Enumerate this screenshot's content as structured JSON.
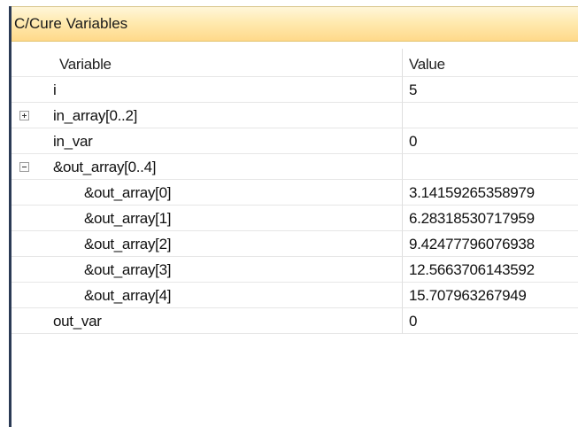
{
  "window": {
    "title": "C/Cure Variables"
  },
  "table": {
    "headers": {
      "variable": "Variable",
      "value": "Value"
    },
    "rows": [
      {
        "name": "i",
        "value": "5",
        "indent": 1,
        "expander": null
      },
      {
        "name": "in_array[0..2]",
        "value": "",
        "indent": 1,
        "expander": "collapsed"
      },
      {
        "name": "in_var",
        "value": "0",
        "indent": 1,
        "expander": null
      },
      {
        "name": "&out_array[0..4]",
        "value": "",
        "indent": 1,
        "expander": "expanded"
      },
      {
        "name": "&out_array[0]",
        "value": "3.14159265358979",
        "indent": 2,
        "expander": null
      },
      {
        "name": "&out_array[1]",
        "value": "6.28318530717959",
        "indent": 2,
        "expander": null
      },
      {
        "name": "&out_array[2]",
        "value": "9.42477796076938",
        "indent": 2,
        "expander": null
      },
      {
        "name": "&out_array[3]",
        "value": "12.5663706143592",
        "indent": 2,
        "expander": null
      },
      {
        "name": "&out_array[4]",
        "value": "15.707963267949",
        "indent": 2,
        "expander": null
      },
      {
        "name": "out_var",
        "value": "0",
        "indent": 1,
        "expander": null
      }
    ]
  },
  "colors": {
    "title_gradient_top": "#fff6d9",
    "title_gradient_bottom": "#ffd98a",
    "frame_left": "#2b3a55",
    "grid_line": "#e6e6e6"
  },
  "icons": {
    "collapsed": "plus-box-icon",
    "expanded": "minus-box-icon"
  }
}
